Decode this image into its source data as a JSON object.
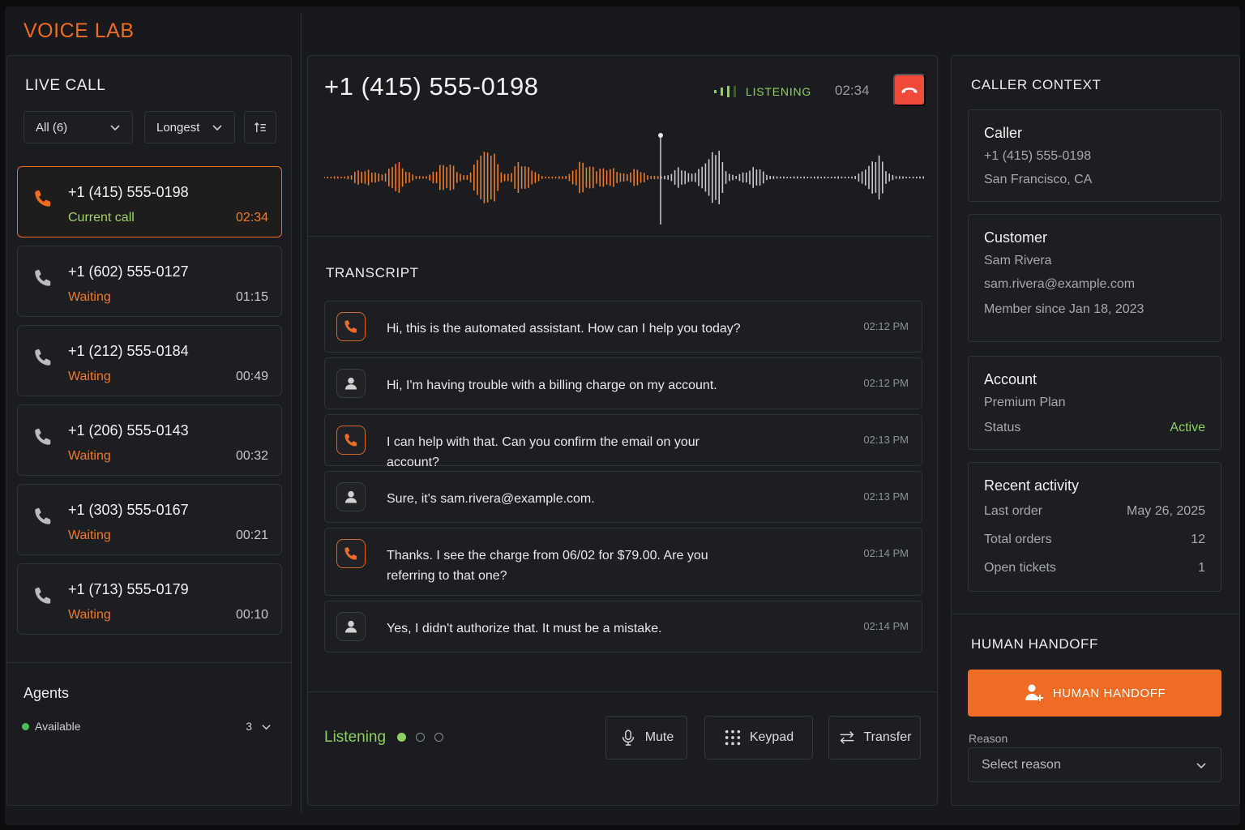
{
  "app": {
    "brand": "VOICE LAB"
  },
  "colors": {
    "accent": "#f06b23",
    "success": "#8fd060",
    "danger": "#ef4a3a"
  },
  "left": {
    "title": "LIVE CALL",
    "filter_all": "All (6)",
    "sort_by": "Longest",
    "sort_icon": "sort-ascending-icon",
    "calls": [
      {
        "number": "+1 (415) 555-0198",
        "status": "Current call",
        "time": "02:34",
        "active": true
      },
      {
        "number": "+1 (602) 555-0127",
        "status": "Waiting",
        "time": "01:15"
      },
      {
        "number": "+1 (212) 555-0184",
        "status": "Waiting",
        "time": "00:49"
      },
      {
        "number": "+1 (206) 555-0143",
        "status": "Waiting",
        "time": "00:32"
      },
      {
        "number": "+1 (303) 555-0167",
        "status": "Waiting",
        "time": "00:21"
      },
      {
        "number": "+1 (713) 555-0179",
        "status": "Waiting",
        "time": "00:10"
      }
    ],
    "agents": {
      "title": "Agents",
      "status_label": "Available",
      "count": "3"
    }
  },
  "center": {
    "caller_number": "+1 (415) 555-0198",
    "state": "LISTENING",
    "timer": "02:34",
    "transcript_title": "TRANSCRIPT",
    "messages": [
      {
        "speaker": "agent",
        "text": "Hi, this is the automated assistant. How can I help you today?",
        "time": "02:12 PM"
      },
      {
        "speaker": "caller",
        "text": "Hi, I'm having trouble with a billing charge on my account.",
        "time": "02:12 PM"
      },
      {
        "speaker": "agent",
        "text": "I can help with that. Can you confirm the email on your account?",
        "time": "02:13 PM"
      },
      {
        "speaker": "caller",
        "text": "Sure, it's sam.rivera@example.com.",
        "time": "02:13 PM"
      },
      {
        "speaker": "agent",
        "text": "Thanks. I see the charge from 06/02 for $79.00. Are you referring to that one?",
        "time": "02:14 PM"
      },
      {
        "speaker": "caller",
        "text": "Yes, I didn't authorize that. It must be a mistake.",
        "time": "02:14 PM"
      }
    ],
    "footer": {
      "status": "Listening",
      "mute": "Mute",
      "keypad": "Keypad",
      "transfer": "Transfer"
    }
  },
  "right": {
    "title": "CALLER CONTEXT",
    "caller": {
      "heading": "Caller",
      "number": "+1 (415) 555-0198",
      "location": "San Francisco, CA"
    },
    "customer": {
      "heading": "Customer",
      "name": "Sam Rivera",
      "email": "sam.rivera@example.com",
      "since": "Member since Jan 18, 2023"
    },
    "account": {
      "heading": "Account",
      "plan": "Premium Plan",
      "status_label": "Status",
      "status_value": "Active"
    },
    "activity": {
      "heading": "Recent activity",
      "last_order_label": "Last order",
      "last_order_value": "May 26, 2025",
      "total_orders_label": "Total orders",
      "total_orders_value": "12",
      "open_tickets_label": "Open tickets",
      "open_tickets_value": "1"
    },
    "handoff": {
      "title": "HUMAN HANDOFF",
      "button": "HUMAN HANDOFF",
      "reason_label": "Reason",
      "reason_placeholder": "Select reason"
    }
  }
}
